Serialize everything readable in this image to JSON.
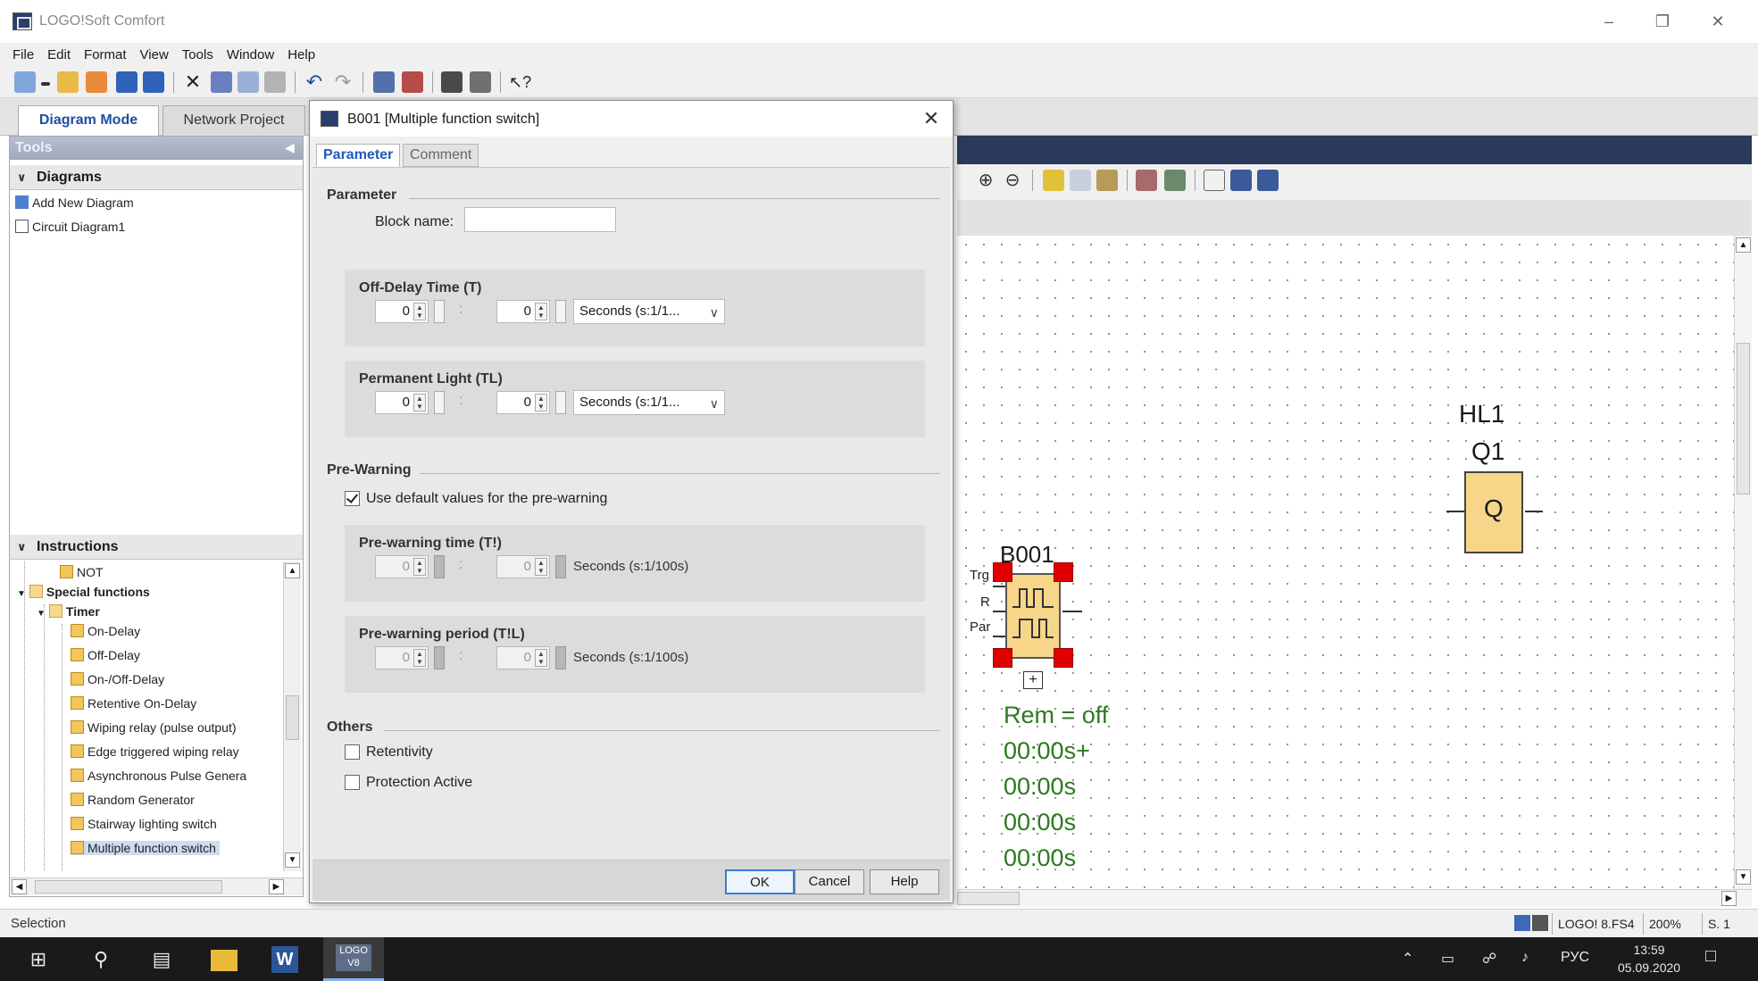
{
  "window": {
    "title": "LOGO!Soft Comfort"
  },
  "menu": [
    "File",
    "Edit",
    "Format",
    "View",
    "Tools",
    "Window",
    "Help"
  ],
  "mode_tabs": {
    "diagram": "Diagram Mode",
    "network": "Network Project"
  },
  "tools_panel": {
    "title": "Tools",
    "diagrams_header": "Diagrams",
    "diagram_items": [
      "Add New Diagram",
      "Circuit Diagram1"
    ],
    "instructions_header": "Instructions",
    "tree": {
      "not": "NOT",
      "special": "Special functions",
      "timer": "Timer",
      "timers": [
        "On-Delay",
        "Off-Delay",
        "On-/Off-Delay",
        "Retentive On-Delay",
        "Wiping relay (pulse output)",
        "Edge triggered wiping relay",
        "Asynchronous Pulse Genera",
        "Random Generator",
        "Stairway lighting switch",
        "Multiple function switch"
      ]
    }
  },
  "dialog": {
    "title": "B001 [Multiple function switch]",
    "tabs": {
      "parameter": "Parameter",
      "comment": "Comment"
    },
    "parameter_group": "Parameter",
    "block_name_label": "Block name:",
    "block_name_value": "",
    "off_delay": {
      "title": "Off-Delay Time (T)",
      "v1": "0",
      "v2": "0",
      "unit": "Seconds (s:1/1..."
    },
    "perm_light": {
      "title": "Permanent Light (TL)",
      "v1": "0",
      "v2": "0",
      "unit": "Seconds (s:1/1..."
    },
    "prewarning_group": "Pre-Warning",
    "use_default_label": "Use default values for the pre-warning",
    "use_default_checked": true,
    "prewarn_time": {
      "title": "Pre-warning time (T!)",
      "v1": "0",
      "v2": "0",
      "unit": "Seconds (s:1/100s)"
    },
    "prewarn_period": {
      "title": "Pre-warning period (T!L)",
      "v1": "0",
      "v2": "0",
      "unit": "Seconds (s:1/100s)"
    },
    "others_group": "Others",
    "retentivity_label": "Retentivity",
    "retentivity_checked": false,
    "protection_label": "Protection Active",
    "protection_checked": false,
    "buttons": {
      "ok": "OK",
      "cancel": "Cancel",
      "help": "Help"
    }
  },
  "diagram": {
    "hl1": "HL1",
    "q1": "Q1",
    "q_text": "Q",
    "b001": "B001",
    "pins": {
      "trg": "Trg",
      "r": "R",
      "par": "Par"
    },
    "expand": "+",
    "param_lines": [
      "Rem = off",
      "00:00s+",
      "00:00s",
      "00:00s",
      "00:00s"
    ]
  },
  "status": {
    "mode": "Selection",
    "device": "LOGO! 8.FS4",
    "zoom": "200%",
    "page": "S. 1"
  },
  "taskbar": {
    "lang": "РУС",
    "time": "13:59",
    "date": "05.09.2020",
    "logo_app": "LOGO V8"
  },
  "colors": {
    "accent": "#1f5bb5",
    "block_fill": "#f7d68a",
    "selected_handle": "#e00000",
    "param_text": "#2c7a1e"
  }
}
